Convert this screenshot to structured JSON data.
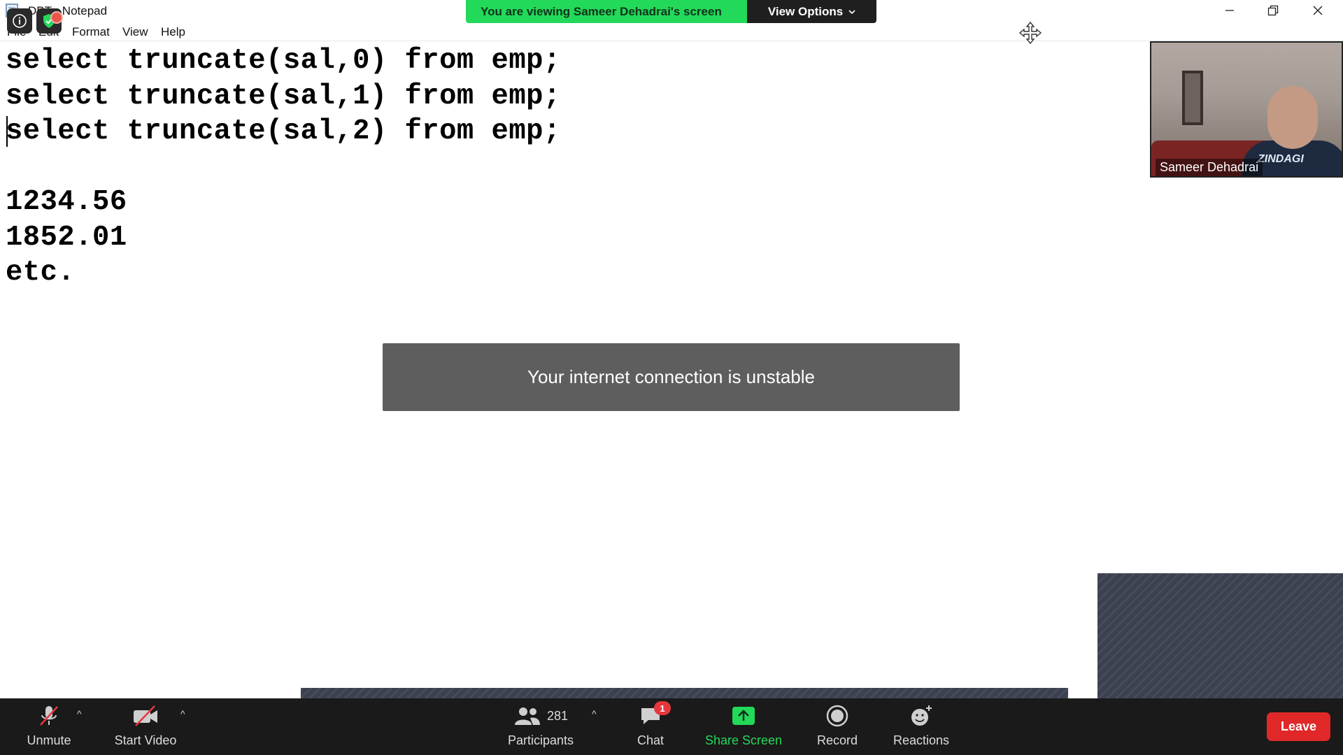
{
  "notepad": {
    "title": "DBT - Notepad",
    "menu": [
      "File",
      "Edit",
      "Format",
      "View",
      "Help"
    ],
    "lines": [
      "select truncate(sal,0) from emp;",
      "select truncate(sal,1) from emp;",
      "select truncate(sal,2) from emp;",
      "",
      "1234.56",
      "1852.01",
      "etc."
    ]
  },
  "zoom": {
    "banner": {
      "viewing_text": "You are viewing Sameer Dehadrai's screen",
      "view_options_label": "View Options"
    },
    "video_tile": {
      "name": "Sameer Dehadrai",
      "shirt_text": "ZINDAGI"
    },
    "toast": "Your internet connection is unstable",
    "controls": {
      "unmute": "Unmute",
      "start_video": "Start Video",
      "participants": "Participants",
      "participants_count": "281",
      "chat": "Chat",
      "chat_badge": "1",
      "share_screen": "Share Screen",
      "record": "Record",
      "reactions": "Reactions",
      "leave": "Leave"
    },
    "colors": {
      "banner_green": "#23d959",
      "leave_red": "#e02828",
      "control_bar": "#1a1a1a",
      "toast_bg": "#5e5e5e"
    }
  }
}
